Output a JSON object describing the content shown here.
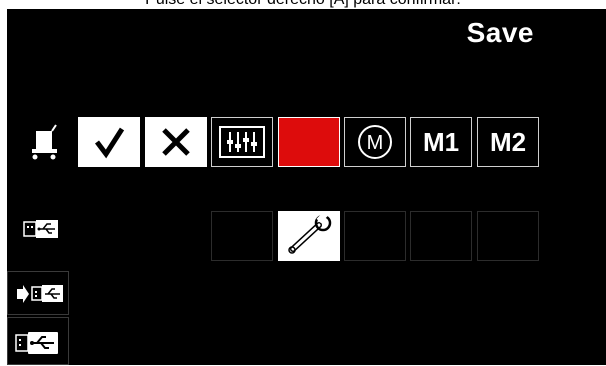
{
  "caption": "Pulse el selector derecho [A] para confirmar:",
  "title": "Save",
  "colors": {
    "screen": "#000000",
    "selected": "#dd0c0c",
    "frame": "#ffffff"
  },
  "top_row": [
    {
      "name": "cart",
      "icon": "cart-icon"
    },
    {
      "name": "confirm",
      "icon": "checkmark-icon"
    },
    {
      "name": "cancel",
      "icon": "x-icon"
    },
    {
      "name": "settings",
      "icon": "sliders-icon"
    },
    {
      "name": "selected-slot",
      "icon": ""
    },
    {
      "name": "memory",
      "icon": "circled-m-icon",
      "label": "M"
    },
    {
      "name": "memory-1",
      "label": "M1"
    },
    {
      "name": "memory-2",
      "label": "M2"
    }
  ],
  "usb_row": [
    {
      "name": "usb",
      "icon": "usb-icon"
    },
    {
      "name": "empty-1"
    },
    {
      "name": "wrench",
      "icon": "wrench-icon"
    },
    {
      "name": "empty-2"
    },
    {
      "name": "empty-3"
    },
    {
      "name": "empty-4"
    }
  ],
  "side_icons": [
    {
      "name": "usb-import",
      "icon": "usb-import-icon"
    },
    {
      "name": "usb-drive",
      "icon": "usb-drive-icon"
    }
  ]
}
